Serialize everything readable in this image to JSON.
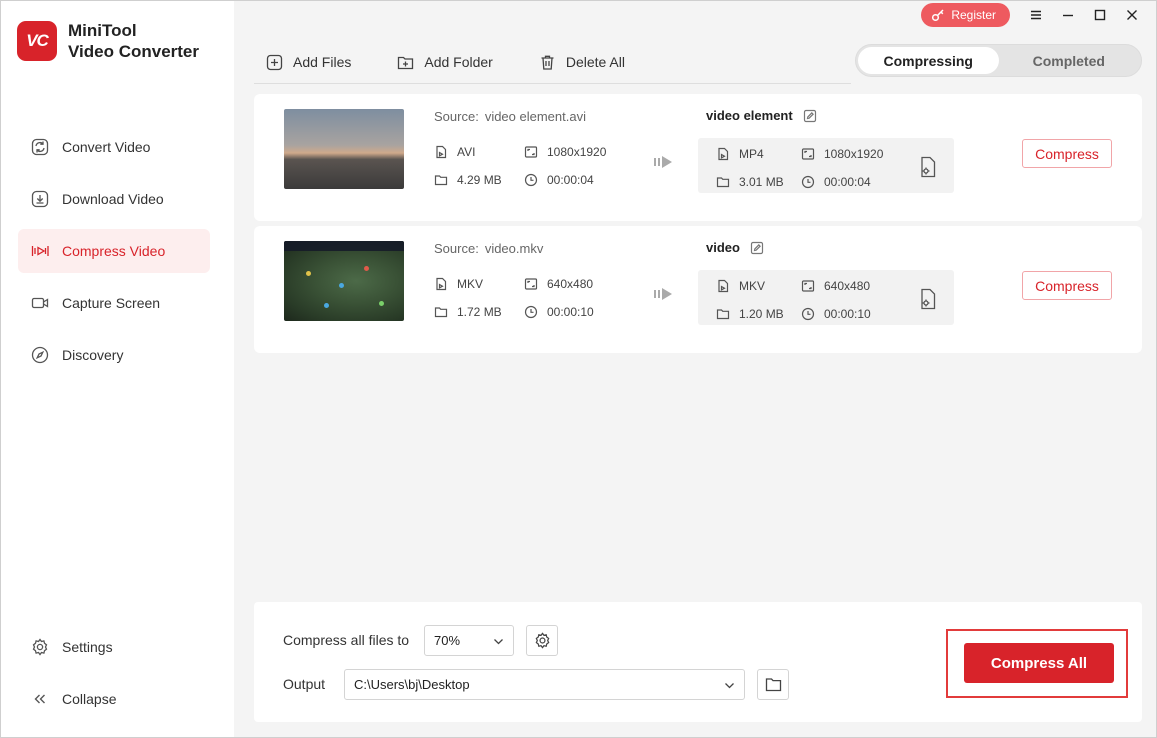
{
  "app": {
    "logo_mark": "VC",
    "title_line1": "MiniTool",
    "title_line2": "Video Converter"
  },
  "window": {
    "register_label": "Register",
    "controls": [
      "menu-icon",
      "minimize-icon",
      "maximize-icon",
      "close-icon"
    ]
  },
  "sidebar": {
    "items": [
      {
        "label": "Convert Video",
        "icon": "convert-icon",
        "active": false
      },
      {
        "label": "Download Video",
        "icon": "download-icon",
        "active": false
      },
      {
        "label": "Compress Video",
        "icon": "compress-icon",
        "active": true
      },
      {
        "label": "Capture Screen",
        "icon": "camera-icon",
        "active": false
      },
      {
        "label": "Discovery",
        "icon": "compass-icon",
        "active": false
      }
    ],
    "bottom": [
      {
        "label": "Settings",
        "icon": "gear-icon"
      },
      {
        "label": "Collapse",
        "icon": "double-chevron-left-icon"
      }
    ]
  },
  "toolbar": {
    "add_files": "Add Files",
    "add_folder": "Add Folder",
    "delete_all": "Delete All"
  },
  "tabs": {
    "compressing": "Compressing",
    "completed": "Completed"
  },
  "files": [
    {
      "source_label": "Source:",
      "source_name": "video element.avi",
      "src_format": "AVI",
      "src_resolution": "1080x1920",
      "src_size": "4.29 MB",
      "src_duration": "00:00:04",
      "out_name": "video element",
      "out_format": "MP4",
      "out_resolution": "1080x1920",
      "out_size": "3.01 MB",
      "out_duration": "00:00:04",
      "action": "Compress"
    },
    {
      "source_label": "Source:",
      "source_name": "video.mkv",
      "src_format": "MKV",
      "src_resolution": "640x480",
      "src_size": "1.72 MB",
      "src_duration": "00:00:10",
      "out_name": "video",
      "out_format": "MKV",
      "out_resolution": "640x480",
      "out_size": "1.20 MB",
      "out_duration": "00:00:10",
      "action": "Compress"
    }
  ],
  "bottom": {
    "compress_label": "Compress all files to",
    "compress_value": "70%",
    "output_label": "Output",
    "output_path": "C:\\Users\\bj\\Desktop",
    "compress_all": "Compress All"
  },
  "colors": {
    "accent": "#d8232a",
    "active_bg": "#fdeeee",
    "register": "#ee5a5f"
  }
}
